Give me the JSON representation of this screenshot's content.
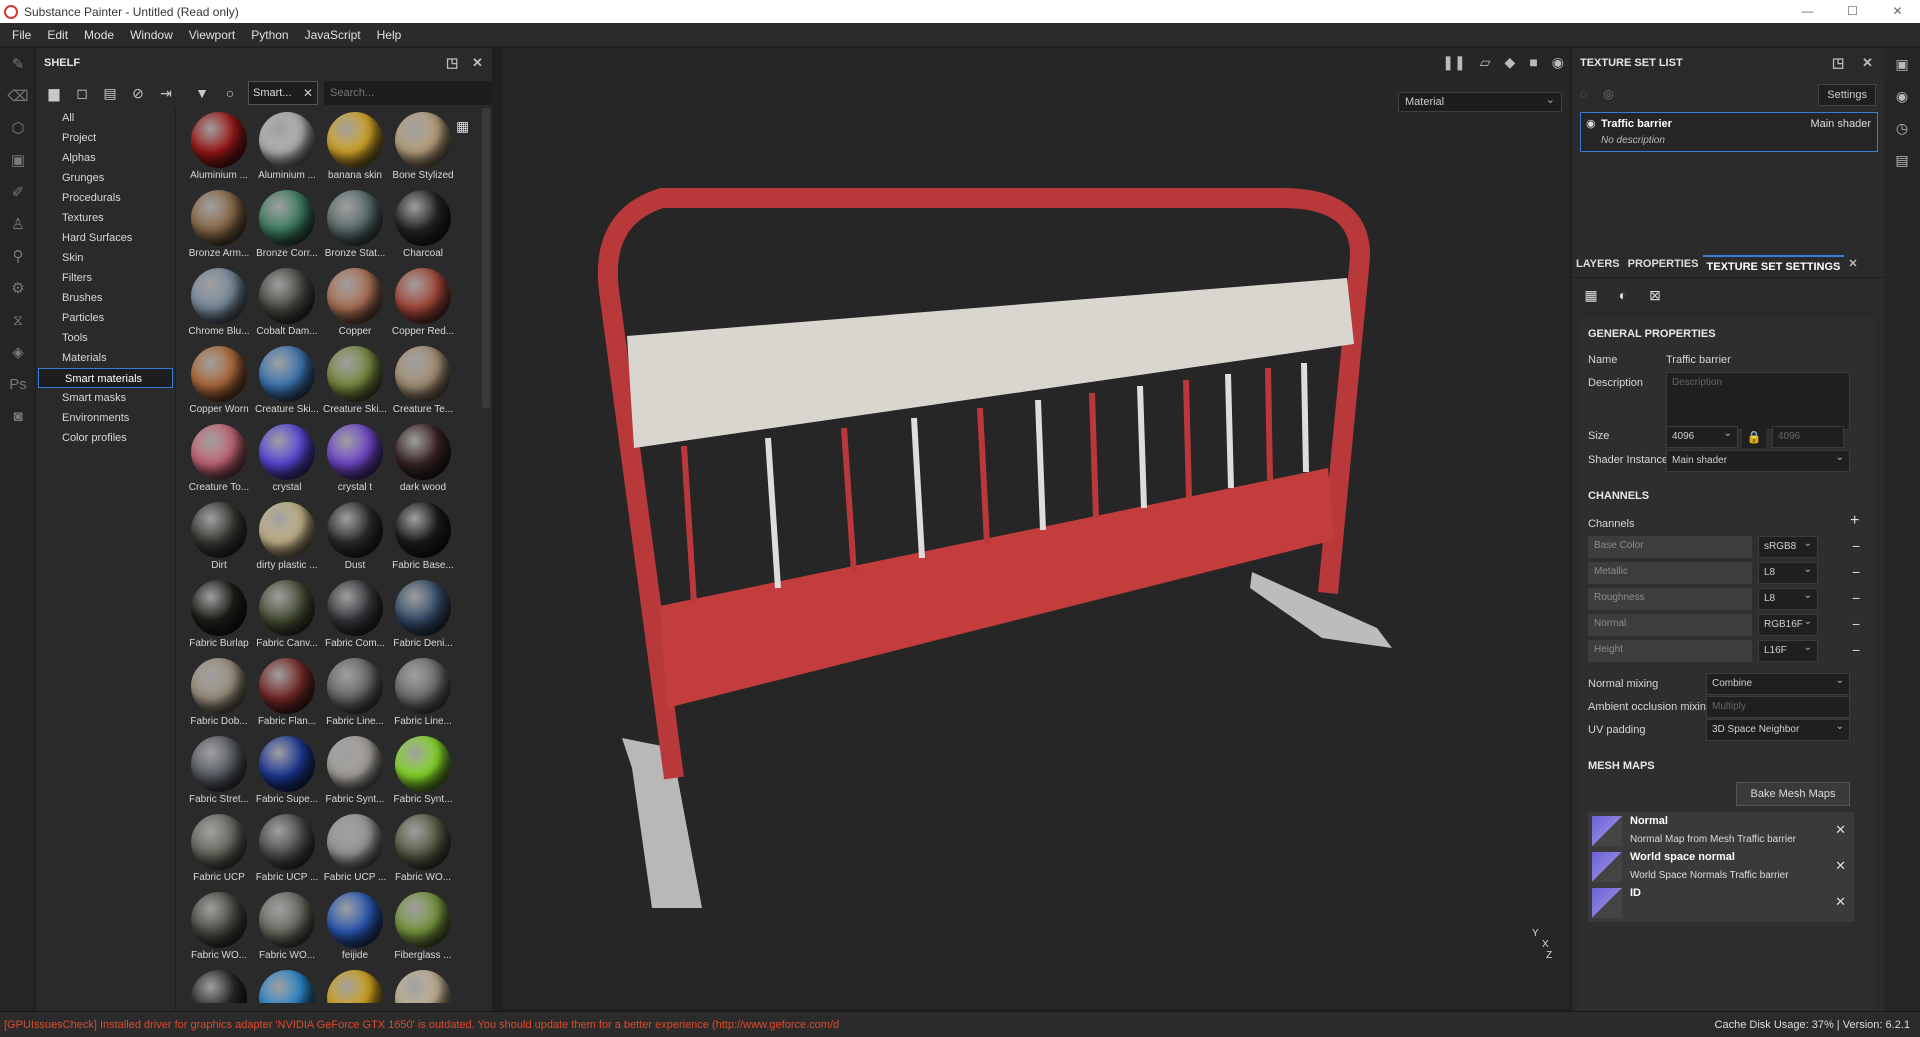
{
  "window": {
    "title": "Substance Painter - Untitled (Read only)"
  },
  "menu": [
    "File",
    "Edit",
    "Mode",
    "Window",
    "Viewport",
    "Python",
    "JavaScript",
    "Help"
  ],
  "shelf": {
    "title": "SHELF",
    "filter_chip": "Smart...",
    "search_placeholder": "Search...",
    "categories": [
      "All",
      "Project",
      "Alphas",
      "Grunges",
      "Procedurals",
      "Textures",
      "Hard Surfaces",
      "Skin",
      "Filters",
      "Brushes",
      "Particles",
      "Tools",
      "Materials",
      "Smart materials",
      "Smart masks",
      "Environments",
      "Color profiles"
    ],
    "selected_category": "Smart materials",
    "materials": [
      {
        "label": "Aluminium ...",
        "color": "#a01818"
      },
      {
        "label": "Aluminium ...",
        "color": "#b8b8bc"
      },
      {
        "label": "banana skin",
        "color": "#d9a92a"
      },
      {
        "label": "Bone Stylized",
        "color": "#bca57f"
      },
      {
        "label": "Bronze Arm...",
        "color": "#8c6b48"
      },
      {
        "label": "Bronze Corr...",
        "color": "#3f8062"
      },
      {
        "label": "Bronze Stat...",
        "color": "#5b6e6e"
      },
      {
        "label": "Charcoal",
        "color": "#252525"
      },
      {
        "label": "Chrome Blu...",
        "color": "#7c8ea0"
      },
      {
        "label": "Cobalt Dam...",
        "color": "#4a4a44"
      },
      {
        "label": "Copper",
        "color": "#b07458"
      },
      {
        "label": "Copper Red...",
        "color": "#a8483a"
      },
      {
        "label": "Copper Worn",
        "color": "#b06a3a"
      },
      {
        "label": "Creature Ski...",
        "color": "#3e78b8"
      },
      {
        "label": "Creature Ski...",
        "color": "#7a8c40"
      },
      {
        "label": "Creature Te...",
        "color": "#a89478"
      },
      {
        "label": "Creature To...",
        "color": "#c86878"
      },
      {
        "label": "crystal",
        "color": "#5a4ae0"
      },
      {
        "label": "crystal t",
        "color": "#7248d0"
      },
      {
        "label": "dark wood",
        "color": "#3a2424"
      },
      {
        "label": "Dirt",
        "color": "#3c3a36"
      },
      {
        "label": "dirty plastic ...",
        "color": "#c8b88c"
      },
      {
        "label": "Dust",
        "color": "#2e2e2c"
      },
      {
        "label": "Fabric Base...",
        "color": "#1c1c1c"
      },
      {
        "label": "Fabric Burlap",
        "color": "#1e1e1a"
      },
      {
        "label": "Fabric Canv...",
        "color": "#4a5238"
      },
      {
        "label": "Fabric Com...",
        "color": "#36383c"
      },
      {
        "label": "Fabric Deni...",
        "color": "#38506e"
      },
      {
        "label": "Fabric Dob...",
        "color": "#a09482"
      },
      {
        "label": "Fabric Flan...",
        "color": "#7a2a2a"
      },
      {
        "label": "Fabric Line...",
        "color": "#6a6a6a"
      },
      {
        "label": "Fabric Line...",
        "color": "#707070"
      },
      {
        "label": "Fabric Stret...",
        "color": "#5a5e66"
      },
      {
        "label": "Fabric Supe...",
        "color": "#1e3a9a"
      },
      {
        "label": "Fabric Synt...",
        "color": "#a8a49e"
      },
      {
        "label": "Fabric Synt...",
        "color": "#8ae02a"
      },
      {
        "label": "Fabric UCP",
        "color": "#6a6a60"
      },
      {
        "label": "Fabric UCP ...",
        "color": "#505050"
      },
      {
        "label": "Fabric UCP ...",
        "color": "#9a9a98"
      },
      {
        "label": "Fabric WO...",
        "color": "#5a5e46"
      },
      {
        "label": "Fabric WO...",
        "color": "#4a4c42"
      },
      {
        "label": "Fabric WO...",
        "color": "#6a6e62"
      },
      {
        "label": "feijide",
        "color": "#2a5ab8"
      },
      {
        "label": "Fiberglass ...",
        "color": "#7a9a40"
      },
      {
        "label": "",
        "color": "#2a2a2a"
      },
      {
        "label": "",
        "color": "#2a8ad0"
      },
      {
        "label": "",
        "color": "#d8a820"
      },
      {
        "label": "",
        "color": "#c8b89a"
      }
    ]
  },
  "viewport": {
    "material_mode": "Material",
    "axis_labels": [
      "Y",
      "X",
      "Z"
    ]
  },
  "texture_set_list": {
    "title": "TEXTURE SET LIST",
    "settings_label": "Settings",
    "item_name": "Traffic barrier",
    "item_shader": "Main shader",
    "item_description": "No description"
  },
  "tabs": [
    "LAYERS",
    "PROPERTIES",
    "TEXTURE SET SETTINGS"
  ],
  "tss": {
    "general_title": "GENERAL PROPERTIES",
    "name_label": "Name",
    "name_value": "Traffic barrier",
    "description_label": "Description",
    "description_placeholder": "Description",
    "size_label": "Size",
    "size_value": "4096",
    "size_value2": "4096",
    "shader_label": "Shader Instance",
    "shader_value": "Main shader",
    "channels_title": "CHANNELS",
    "channels_label": "Channels",
    "channels": [
      {
        "name": "Base Color",
        "format": "sRGB8"
      },
      {
        "name": "Metallic",
        "format": "L8"
      },
      {
        "name": "Roughness",
        "format": "L8"
      },
      {
        "name": "Normal",
        "format": "RGB16F"
      },
      {
        "name": "Height",
        "format": "L16F"
      }
    ],
    "normal_mixing_label": "Normal mixing",
    "normal_mixing_value": "Combine",
    "ao_mixing_label": "Ambient occlusion mixing",
    "ao_mixing_value": "Multiply",
    "uv_padding_label": "UV padding",
    "uv_padding_value": "3D Space Neighbor",
    "mesh_maps_title": "MESH MAPS",
    "bake_label": "Bake Mesh Maps",
    "mesh_maps": [
      {
        "title": "Normal",
        "sub": "Normal Map from Mesh Traffic barrier"
      },
      {
        "title": "World space normal",
        "sub": "World Space Normals Traffic barrier"
      },
      {
        "title": "ID",
        "sub": ""
      }
    ]
  },
  "status": {
    "error": "[GPUIssuesCheck] Installed driver for graphics adapter 'NVIDIA GeForce GTX 1650' is outdated. You should update them for a better experience (http://www.geforce.com/d...",
    "cache": "Cache Disk Usage:   37% | Version: 6.2.1"
  }
}
